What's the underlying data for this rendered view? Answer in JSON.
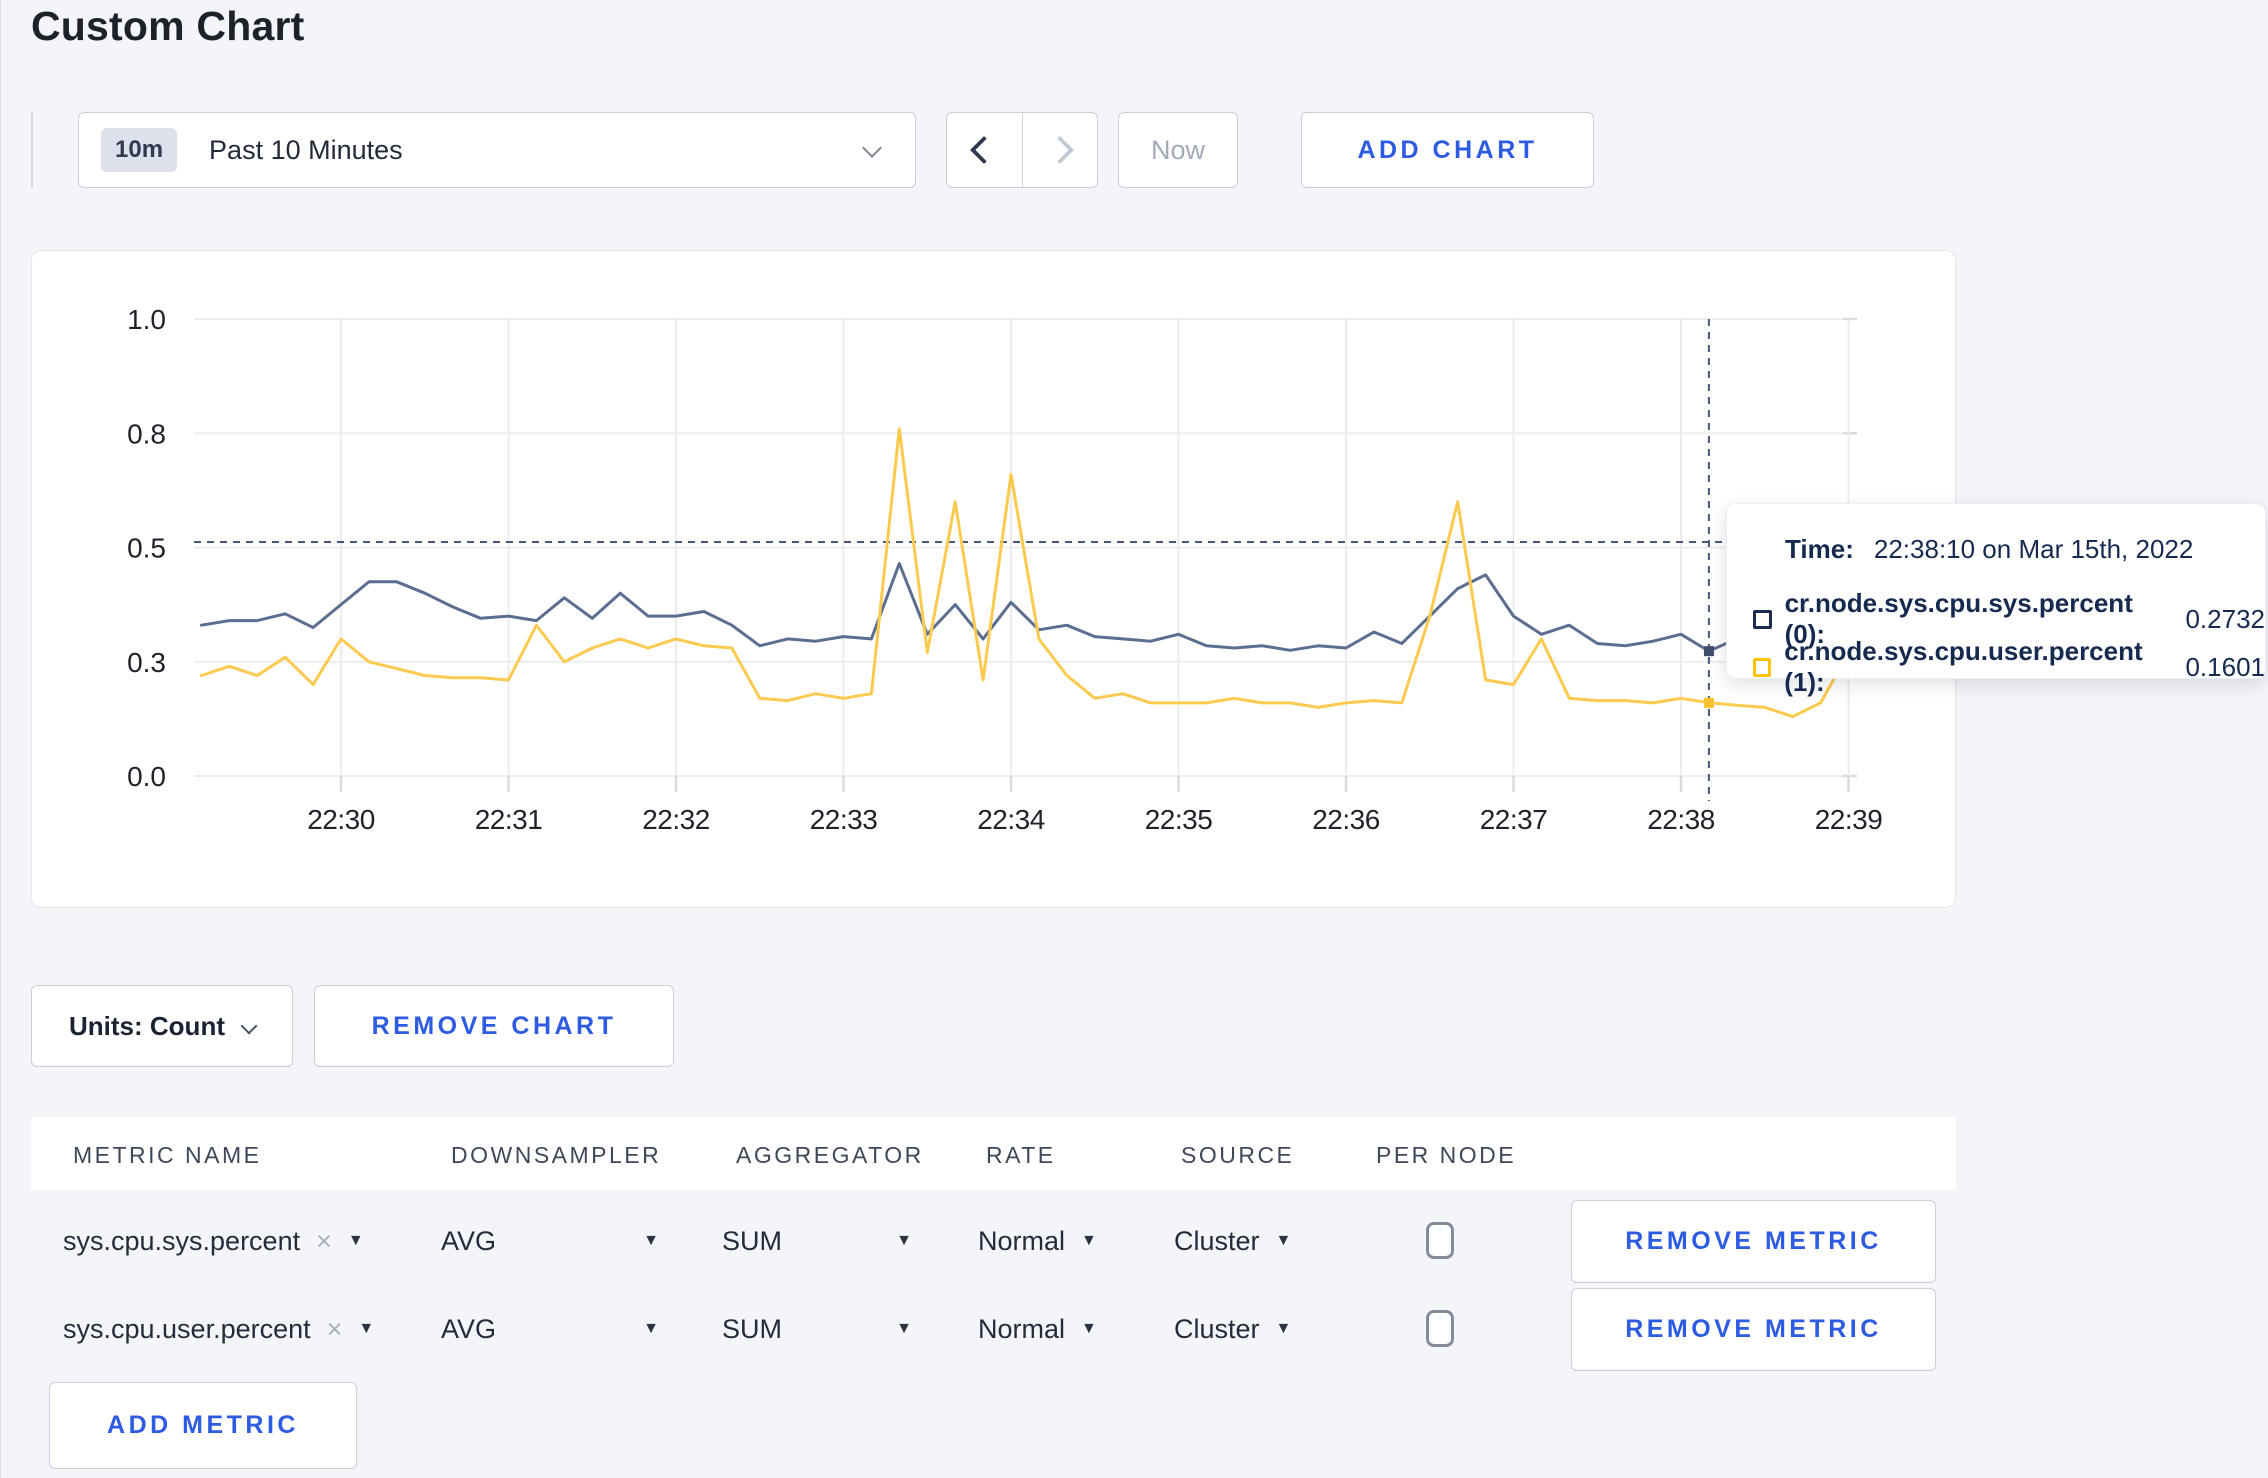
{
  "page": {
    "title": "Custom Chart",
    "background": "#f3f5f8",
    "accent_blue": "#2d5be2"
  },
  "toolbar": {
    "time_badge": "10m",
    "time_label": "Past 10 Minutes",
    "now_label": "Now",
    "add_chart_label": "ADD CHART"
  },
  "chart_data": {
    "type": "line",
    "title": "",
    "xlabel": "",
    "ylabel": "",
    "ylim": [
      0,
      1
    ],
    "grid": true,
    "x_ticks": [
      "22:30",
      "22:31",
      "22:32",
      "22:33",
      "22:34",
      "22:35",
      "22:36",
      "22:37",
      "22:38",
      "22:39"
    ],
    "y_ticks": {
      "labels": [
        "0.0",
        "0.3",
        "0.5",
        "0.8",
        "1.0"
      ],
      "values": [
        0,
        0.25,
        0.5,
        0.75,
        1.0
      ]
    },
    "start_time": "22:29:10",
    "interval_seconds": 10,
    "series": [
      {
        "name": "cr.node.sys.cpu.sys.percent",
        "color": "#5c6e90",
        "dot_color": "#3d4c6b",
        "values": [
          0.33,
          0.34,
          0.34,
          0.355,
          0.325,
          0.375,
          0.425,
          0.425,
          0.4,
          0.37,
          0.345,
          0.35,
          0.34,
          0.39,
          0.345,
          0.4,
          0.35,
          0.35,
          0.36,
          0.33,
          0.285,
          0.3,
          0.295,
          0.305,
          0.3,
          0.465,
          0.31,
          0.375,
          0.3,
          0.38,
          0.32,
          0.33,
          0.305,
          0.3,
          0.295,
          0.31,
          0.285,
          0.28,
          0.285,
          0.275,
          0.285,
          0.28,
          0.315,
          0.29,
          0.35,
          0.41,
          0.44,
          0.35,
          0.31,
          0.33,
          0.29,
          0.285,
          0.295,
          0.31,
          0.2732,
          0.3,
          0.305,
          0.3,
          0.295,
          0.31
        ]
      },
      {
        "name": "cr.node.sys.cpu.user.percent",
        "color": "#fdca50",
        "dot_color": "#fcc22e",
        "values": [
          0.22,
          0.24,
          0.22,
          0.26,
          0.2,
          0.3,
          0.25,
          0.235,
          0.22,
          0.215,
          0.215,
          0.21,
          0.33,
          0.25,
          0.28,
          0.3,
          0.28,
          0.3,
          0.285,
          0.28,
          0.17,
          0.165,
          0.18,
          0.17,
          0.18,
          0.76,
          0.27,
          0.6,
          0.21,
          0.66,
          0.3,
          0.22,
          0.17,
          0.18,
          0.16,
          0.16,
          0.16,
          0.17,
          0.16,
          0.16,
          0.15,
          0.16,
          0.165,
          0.16,
          0.35,
          0.6,
          0.21,
          0.2,
          0.3,
          0.17,
          0.165,
          0.165,
          0.16,
          0.17,
          0.1601,
          0.155,
          0.15,
          0.13,
          0.16,
          0.27
        ]
      }
    ],
    "crosshair": {
      "time": "22:38:10",
      "x_offset_seconds": 540,
      "index": 54,
      "y_value": 0.512
    },
    "legend_position": "tooltip"
  },
  "tooltip": {
    "time_label": "Time:",
    "time_value": "22:38:10 on Mar 15th, 2022",
    "rows": [
      {
        "label": "cr.node.sys.cpu.sys.percent (0):",
        "value": "0.2732",
        "swatch_color": "#1c2b50"
      },
      {
        "label": "cr.node.sys.cpu.user.percent (1):",
        "value": "0.1601",
        "swatch_color": "#ffc40d"
      }
    ]
  },
  "chart_controls": {
    "units_label": "Units: Count",
    "remove_chart_label": "REMOVE CHART"
  },
  "metrics_table": {
    "headers": [
      "METRIC NAME",
      "DOWNSAMPLER",
      "AGGREGATOR",
      "RATE",
      "SOURCE",
      "PER NODE"
    ],
    "rows": [
      {
        "metric_name": "sys.cpu.sys.percent",
        "downsampler": "AVG",
        "aggregator": "SUM",
        "rate": "Normal",
        "source": "Cluster",
        "per_node_checked": false,
        "remove_label": "REMOVE METRIC"
      },
      {
        "metric_name": "sys.cpu.user.percent",
        "downsampler": "AVG",
        "aggregator": "SUM",
        "rate": "Normal",
        "source": "Cluster",
        "per_node_checked": false,
        "remove_label": "REMOVE METRIC"
      }
    ],
    "add_metric_label": "ADD METRIC"
  }
}
